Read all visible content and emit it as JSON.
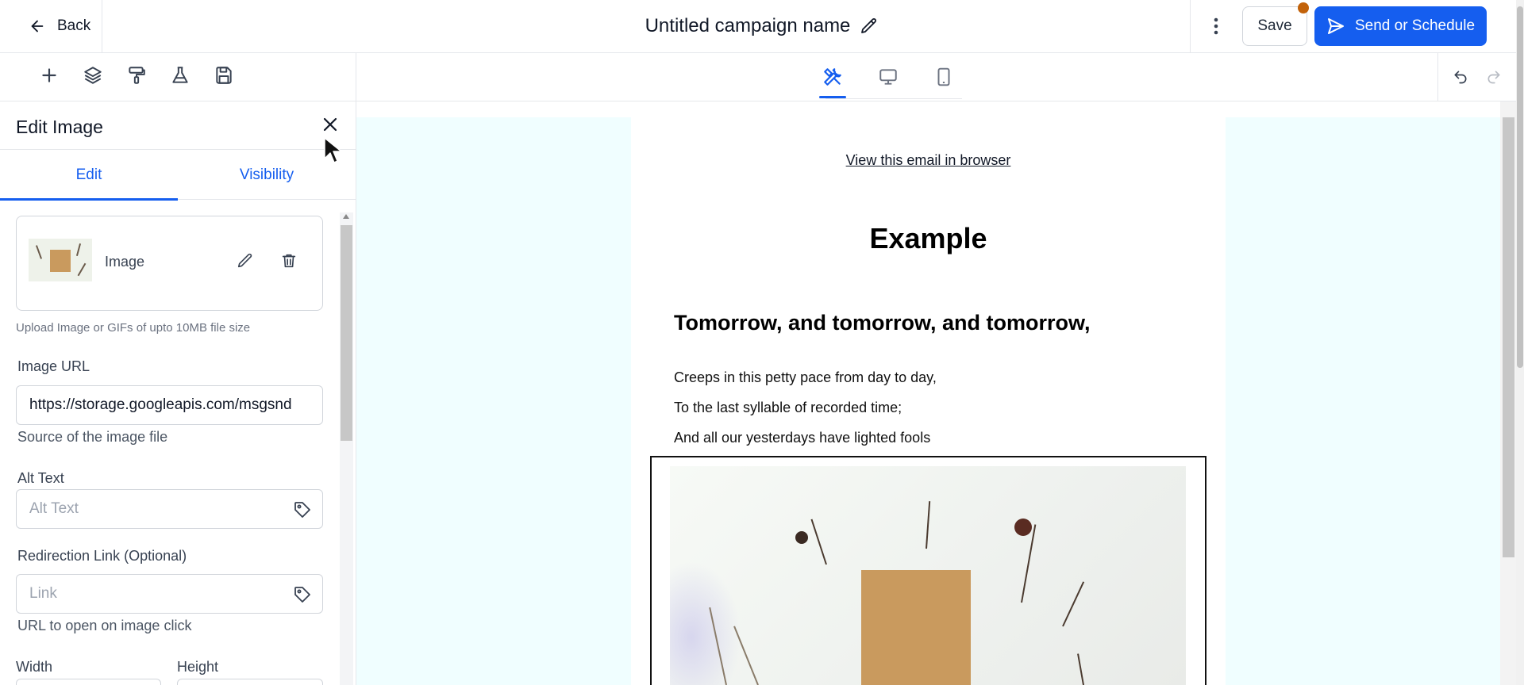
{
  "header": {
    "back_label": "Back",
    "campaign_name": "Untitled campaign name",
    "save_label": "Save",
    "send_label": "Send or Schedule",
    "brand_color": "#155eef",
    "unsaved_dot_color": "#c2620a"
  },
  "toolbar": {
    "left_icons": [
      "plus-icon",
      "layers-icon",
      "paint-roller-icon",
      "flask-icon",
      "floppy-disk-icon"
    ],
    "view_modes": [
      "tools-icon",
      "desktop-icon",
      "mobile-icon"
    ],
    "active_view": "tools-icon"
  },
  "panel": {
    "title": "Edit Image",
    "tabs": [
      {
        "label": "Edit",
        "active": true
      },
      {
        "label": "Visibility",
        "active": false
      }
    ],
    "image_card_label": "Image",
    "upload_hint": "Upload Image or GIFs of upto 10MB file size",
    "image_url_label": "Image URL",
    "image_url_value": "https://storage.googleapis.com/msgsnd",
    "image_url_help": "Source of the image file",
    "alt_text_label": "Alt Text",
    "alt_text_placeholder": "Alt Text",
    "redirect_label": "Redirection Link (Optional)",
    "redirect_placeholder": "Link",
    "redirect_help": "URL to open on image click",
    "width_label": "Width",
    "height_label": "Height"
  },
  "email": {
    "view_in_browser": "View this email in browser",
    "heading": "Example",
    "subheading": "Tomorrow, and tomorrow, and tomorrow,",
    "lines": [
      "Creeps in this petty pace from day to day,",
      "To the last syllable of recorded time;",
      "And all our yesterdays have lighted fools"
    ],
    "canvas_bg_color": "#f0feff"
  }
}
